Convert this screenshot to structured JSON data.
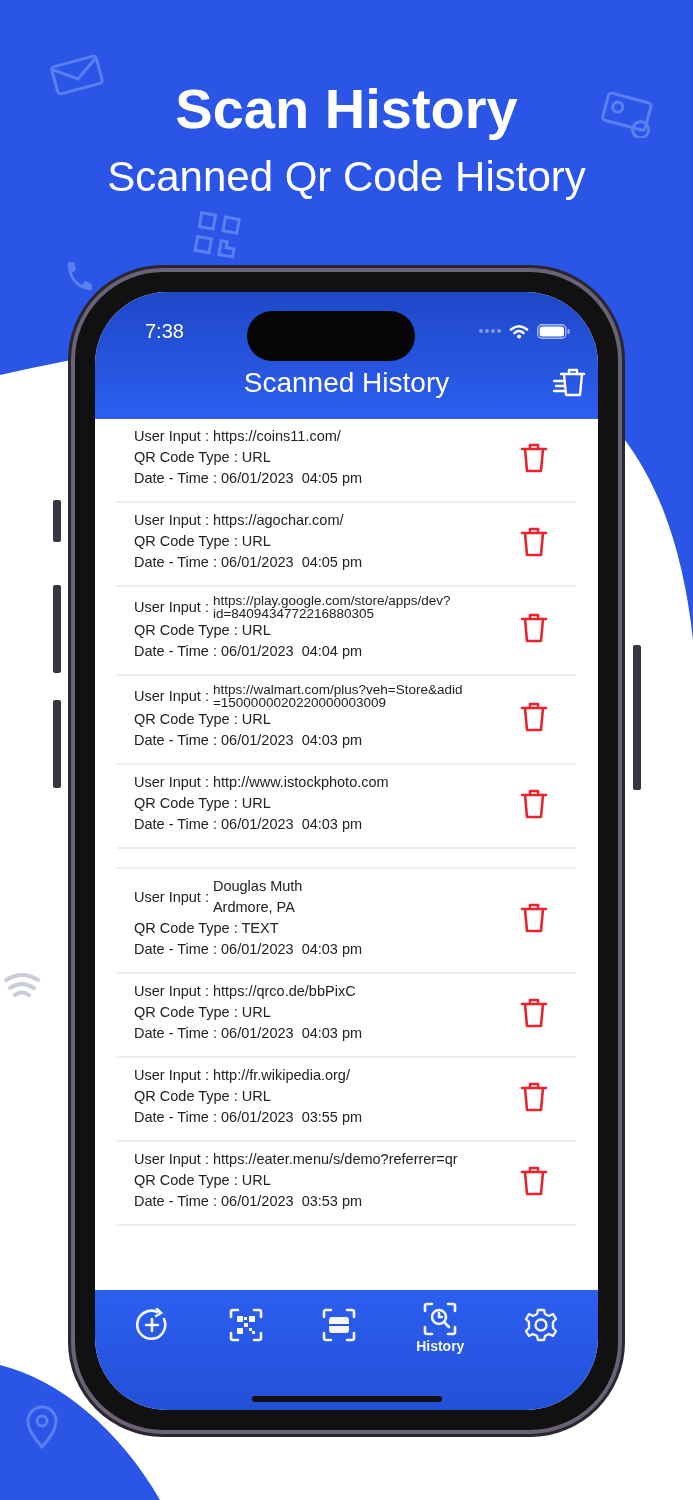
{
  "promo": {
    "title": "Scan History",
    "subtitle": "Scanned Qr Code History"
  },
  "status_bar": {
    "time": "7:38"
  },
  "header": {
    "title": "Scanned History"
  },
  "records": [
    {
      "kind": "record",
      "label": "User Input :",
      "input": [
        "https://coins11.com/"
      ],
      "type": "QR Code Type : URL",
      "datetime": "Date - Time : 06/01/2023  04:05 pm"
    },
    {
      "kind": "record",
      "label": "User Input :",
      "input": [
        "https://agochar.com/"
      ],
      "type": "QR Code Type : URL",
      "datetime": "Date - Time : 06/01/2023  04:05 pm"
    },
    {
      "kind": "record",
      "label": "User Input :",
      "input": [
        "https://play.google.com/store/apps/dev?",
        "id=8409434772216880305"
      ],
      "type": "QR Code Type : URL",
      "datetime": "Date - Time : 06/01/2023  04:04 pm"
    },
    {
      "kind": "record",
      "label": "User Input :",
      "input": [
        "https://walmart.com/plus?veh=Store&adid",
        "=1500000020220000003009"
      ],
      "type": "QR Code Type : URL",
      "datetime": "Date - Time : 06/01/2023  04:03 pm"
    },
    {
      "kind": "record",
      "label": "User Input :",
      "input": [
        "http://www.istockphoto.com"
      ],
      "type": "QR Code Type : URL",
      "datetime": "Date - Time : 06/01/2023  04:03 pm"
    },
    {
      "kind": "empty"
    },
    {
      "kind": "record",
      "label": "User Input :",
      "input": [
        "Douglas Muth",
        "Ardmore, PA"
      ],
      "type": "QR Code Type : TEXT",
      "datetime": "Date - Time : 06/01/2023  04:03 pm"
    },
    {
      "kind": "record",
      "label": "User Input :",
      "input": [
        "https://qrco.de/bbPixC"
      ],
      "type": "QR Code Type : URL",
      "datetime": "Date - Time : 06/01/2023  04:03 pm"
    },
    {
      "kind": "record",
      "label": "User Input :",
      "input": [
        "http://fr.wikipedia.org/"
      ],
      "type": "QR Code Type : URL",
      "datetime": "Date - Time : 06/01/2023  03:55 pm"
    },
    {
      "kind": "record",
      "label": "User Input :",
      "input": [
        "https://eater.menu/s/demo?referrer=qr"
      ],
      "type": "QR Code Type : URL",
      "datetime": "Date - Time : 06/01/2023  03:53 pm"
    }
  ],
  "tabs": [
    {
      "kind": "create",
      "selected": false
    },
    {
      "kind": "qr",
      "selected": false
    },
    {
      "kind": "scan",
      "selected": false
    },
    {
      "kind": "history",
      "label": "History",
      "selected": true
    },
    {
      "kind": "settings",
      "selected": false
    }
  ]
}
